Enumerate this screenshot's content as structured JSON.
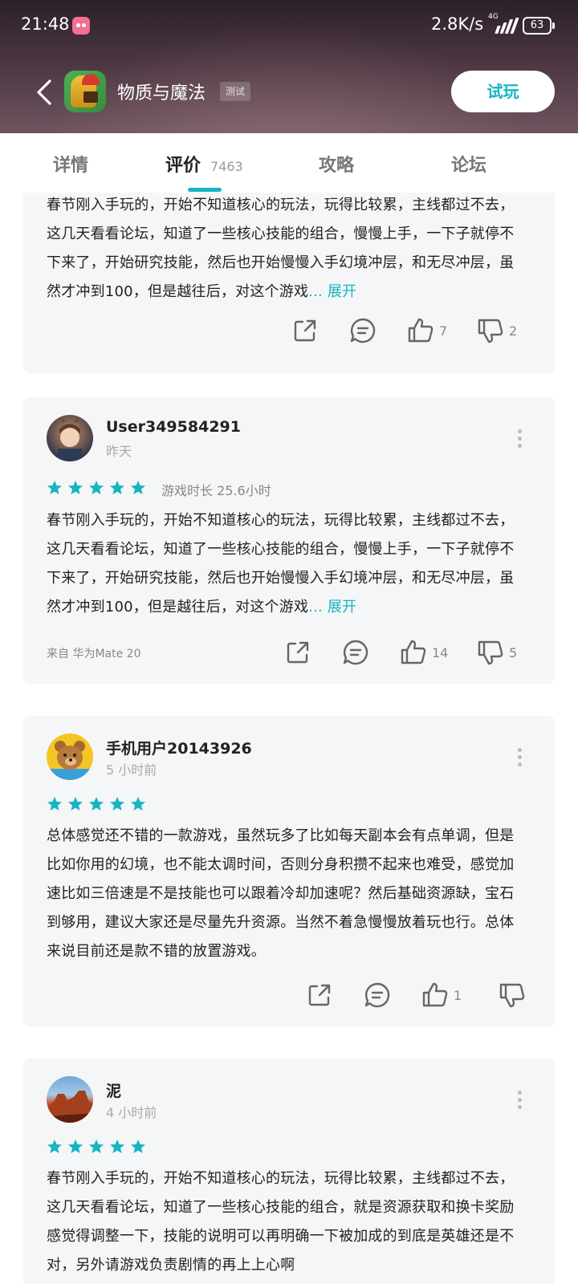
{
  "status_bar": {
    "time": "21:48",
    "net_speed": "2.8K/s",
    "network_type": "4G",
    "battery": "63"
  },
  "app_header": {
    "name": "物质与魔法",
    "badge": "测试",
    "try_button": "试玩"
  },
  "tabs": [
    {
      "label": "详情",
      "count": ""
    },
    {
      "label": "评价",
      "count": "7463"
    },
    {
      "label": "攻略",
      "count": ""
    },
    {
      "label": "论坛",
      "count": ""
    }
  ],
  "reviews": [
    {
      "text": "春节刚入手玩的，开始不知道核心的玩法，玩得比较累，主线都过不去，这几天看看论坛，知道了一些核心技能的组合，慢慢上手，一下子就停不下来了，开始研究技能，然后也开始慢慢入手幻境冲层，和无尽冲层，虽然才冲到100，但是越往后，对这个游戏",
      "expand": "... 展开",
      "likes": "7",
      "dislikes": "2"
    },
    {
      "username": "User349584291",
      "time": "昨天",
      "rating": 5,
      "playtime": "游戏时长 25.6小时",
      "text": "春节刚入手玩的，开始不知道核心的玩法，玩得比较累，主线都过不去，这几天看看论坛，知道了一些核心技能的组合，慢慢上手，一下子就停不下来了，开始研究技能，然后也开始慢慢入手幻境冲层，和无尽冲层，虽然才冲到100，但是越往后，对这个游戏",
      "expand": "... 展开",
      "device": "来自 华为Mate 20",
      "likes": "14",
      "dislikes": "5"
    },
    {
      "username": "手机用户20143926",
      "time": "5 小时前",
      "rating": 5,
      "text": "总体感觉还不错的一款游戏，虽然玩多了比如每天副本会有点单调，但是比如你用的幻境，也不能太调时间，否则分身积攒不起来也难受，感觉加速比如三倍速是不是技能也可以跟着冷却加速呢？然后基础资源缺，宝石到够用，建议大家还是尽量先升资源。当然不着急慢慢放着玩也行。总体来说目前还是款不错的放置游戏。",
      "likes": "1",
      "dislikes": ""
    },
    {
      "username": "泥",
      "time": "4 小时前",
      "rating": 5,
      "text": "春节刚入手玩的，开始不知道核心的玩法，玩得比较累，主线都过不去，这几天看看论坛，知道了一些核心技能的组合，就是资源获取和换卡奖励感觉得调整一下，技能的说明可以再明确一下被加成的到底是英雄还是不对，另外请游戏负责剧情的再上上心啊"
    }
  ],
  "colors": {
    "accent": "#15b5c3",
    "card_bg": "#f5f6f7"
  },
  "icons": [
    "back-arrow-icon",
    "share-icon",
    "comment-icon",
    "thumbs-up-icon",
    "thumbs-down-icon",
    "more-icon",
    "star-icon"
  ]
}
